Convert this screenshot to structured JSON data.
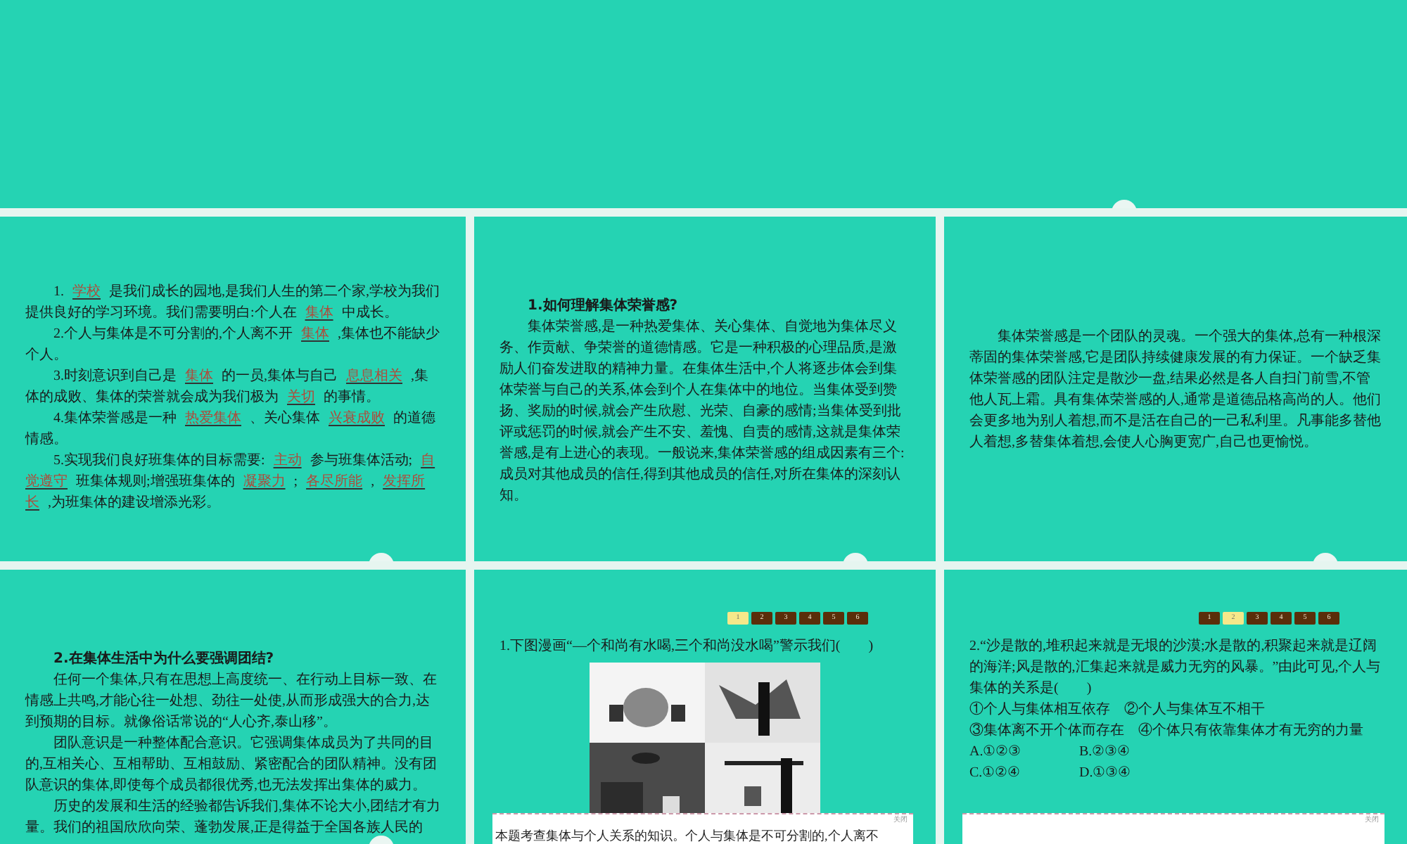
{
  "slides": [
    {
      "kind": "blank"
    },
    {
      "kind": "fill_in",
      "paragraphs": [
        [
          {
            "kind": "text",
            "text": "1."
          },
          {
            "kind": "blank",
            "text": "学校"
          },
          {
            "kind": "text",
            "text": "是我们成长的园地,是我们人生的第二个家,学校为我们提供良好的学习环境。我们需要明白:个人在"
          },
          {
            "kind": "blank",
            "text": "集体"
          },
          {
            "kind": "text",
            "text": "中成长。"
          }
        ],
        [
          {
            "kind": "text",
            "text": "2.个人与集体是不可分割的,个人离不开"
          },
          {
            "kind": "blank",
            "text": "集体"
          },
          {
            "kind": "text",
            "text": ",集体也不能缺少个人。"
          }
        ],
        [
          {
            "kind": "text",
            "text": "3.时刻意识到自己是"
          },
          {
            "kind": "blank",
            "text": "集体"
          },
          {
            "kind": "text",
            "text": "的一员,集体与自己"
          },
          {
            "kind": "blank",
            "text": "息息相关"
          },
          {
            "kind": "text",
            "text": ",集体的成败、集体的荣誉就会成为我们极为"
          },
          {
            "kind": "blank",
            "text": "关切"
          },
          {
            "kind": "text",
            "text": "的事情。"
          }
        ],
        [
          {
            "kind": "text",
            "text": "4.集体荣誉感是一种"
          },
          {
            "kind": "blank",
            "text": "热爱集体"
          },
          {
            "kind": "text",
            "text": "、关心集体"
          },
          {
            "kind": "blank",
            "text": "兴衰成败"
          },
          {
            "kind": "text",
            "text": "的道德情感。"
          }
        ],
        [
          {
            "kind": "text",
            "text": "5.实现我们良好班集体的目标需要:"
          },
          {
            "kind": "blank",
            "text": "主动"
          },
          {
            "kind": "text",
            "text": "参与班集体活动;"
          },
          {
            "kind": "blank",
            "text": "自觉遵守"
          },
          {
            "kind": "text",
            "text": "班集体规则;增强班集体的"
          },
          {
            "kind": "blank",
            "text": "凝聚力"
          },
          {
            "kind": "text",
            "text": ";"
          },
          {
            "kind": "blank",
            "text": "各尽所能"
          },
          {
            "kind": "text",
            "text": ","
          },
          {
            "kind": "blank",
            "text": "发挥所长"
          },
          {
            "kind": "text",
            "text": ",为班集体的建设增添光彩。"
          }
        ]
      ]
    },
    {
      "kind": "text",
      "title": "1.如何理解集体荣誉感?",
      "paragraphs": [
        "集体荣誉感,是一种热爱集体、关心集体、自觉地为集体尽义务、作贡献、争荣誉的道德情感。它是一种积极的心理品质,是激励人们奋发进取的精神力量。在集体生活中,个人将逐步体会到集体荣誉与自己的关系,体会到个人在集体中的地位。当集体受到赞扬、奖励的时候,就会产生欣慰、光荣、自豪的感情;当集体受到批评或惩罚的时候,就会产生不安、羞愧、自责的感情,这就是集体荣誉感,是有上进心的表现。一般说来,集体荣誉感的组成因素有三个:成员对其他成员的信任,得到其他成员的信任,对所在集体的深刻认知。"
      ]
    },
    {
      "kind": "text",
      "paragraphs": [
        "集体荣誉感是一个团队的灵魂。一个强大的集体,总有一种根深蒂固的集体荣誉感,它是团队持续健康发展的有力保证。一个缺乏集体荣誉感的团队注定是散沙一盘,结果必然是各人自扫门前雪,不管他人瓦上霜。具有集体荣誉感的人,通常是道德品格高尚的人。他们会更多地为别人着想,而不是活在自己的一己私利里。凡事能多替他人着想,多替集体着想,会使人心胸更宽广,自己也更愉悦。"
      ]
    },
    {
      "kind": "text",
      "title": "2.在集体生活中为什么要强调团结?",
      "paragraphs": [
        "任何一个集体,只有在思想上高度统一、在行动上目标一致、在情感上共鸣,才能心往一处想、劲往一处使,从而形成强大的合力,达到预期的目标。就像俗话常说的“人心齐,泰山移”。",
        "团队意识是一种整体配合意识。它强调集体成员为了共同的目的,互相关心、互相帮助、互相鼓励、紧密配合的团队精神。没有团队意识的集体,即使每个成员都很优秀,也无法发挥出集体的威力。",
        "历史的发展和生活的经验都告诉我们,集体不论大小,团结才有力量。我们的祖国欣欣向荣、蓬勃发展,正是得益于全国各族人民的"
      ]
    },
    {
      "kind": "question",
      "nav": [
        {
          "label": "1",
          "selected": true
        },
        {
          "label": "2",
          "selected": false
        },
        {
          "label": "3",
          "selected": false
        },
        {
          "label": "4",
          "selected": false
        },
        {
          "label": "5",
          "selected": false
        },
        {
          "label": "6",
          "selected": false
        }
      ],
      "question": "1.下图漫画“—个和尚有水喝,三个和尚没水喝”警示我们(　　)",
      "picture": {
        "kind": "picture"
      },
      "answer": {
        "close": "关闭",
        "text": "本题考查集体与个人关系的知识。个人与集体是不可分割的,个人离不"
      }
    },
    {
      "kind": "question",
      "nav": [
        {
          "label": "1",
          "selected": false
        },
        {
          "label": "2",
          "selected": true
        },
        {
          "label": "3",
          "selected": false
        },
        {
          "label": "4",
          "selected": false
        },
        {
          "label": "5",
          "selected": false
        },
        {
          "label": "6",
          "selected": false
        }
      ],
      "question": "2.“沙是散的,堆积起来就是无垠的沙漠;水是散的,积聚起来就是辽阔的海洋;风是散的,汇集起来就是威力无穷的风暴。”由此可见,个人与集体的关系是(　　)",
      "lines": [
        [
          "①个人与集体相互依存",
          "②个人与集体互不相干"
        ],
        [
          "③集体离不开个体而存在",
          "④个体只有依靠集体才有无穷的力量"
        ],
        [
          "A.①②③",
          "B.②③④"
        ],
        [
          "C.①②④",
          "D.①③④"
        ]
      ],
      "answer": {
        "close": "关闭"
      }
    }
  ]
}
